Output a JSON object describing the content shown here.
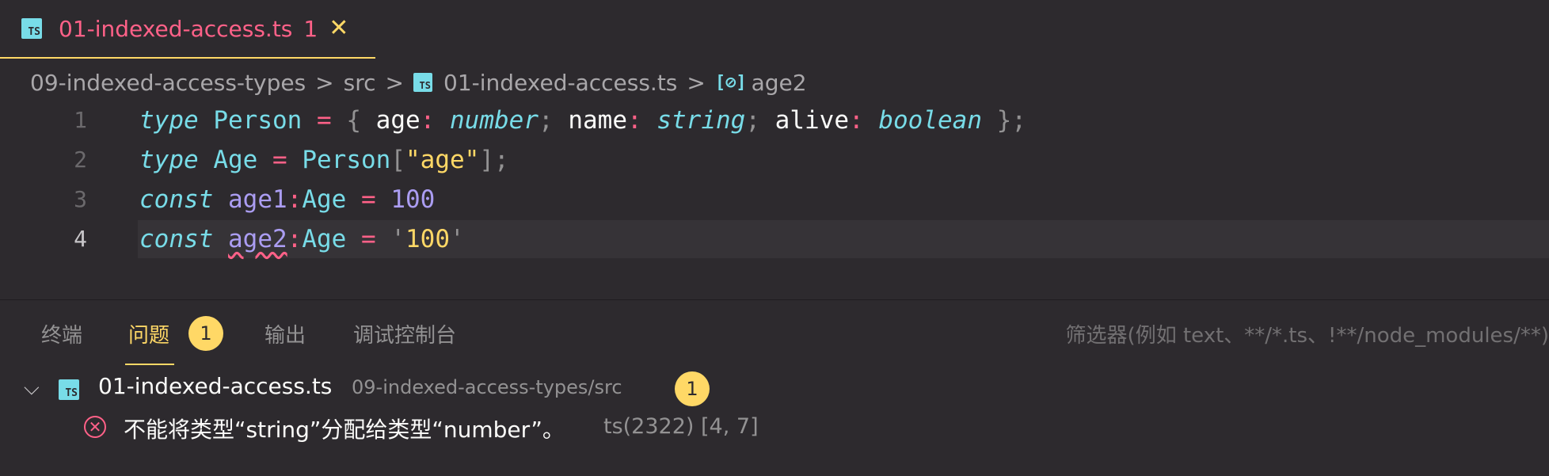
{
  "tab": {
    "title": "01-indexed-access.ts",
    "problem_count": "1",
    "close_glyph": "✕",
    "icon": "ts-file-icon"
  },
  "breadcrumb": {
    "items": [
      "09-indexed-access-types",
      "src",
      "01-indexed-access.ts",
      "age2"
    ],
    "separator": ">"
  },
  "editor": {
    "lines": [
      {
        "number": "1"
      },
      {
        "number": "2"
      },
      {
        "number": "3"
      },
      {
        "number": "4"
      }
    ],
    "tokens": {
      "type": "type",
      "person": "Person",
      "eq": "=",
      "lbrace": "{",
      "rbrace": "}",
      "age": "age",
      "colon": ":",
      "number": "number",
      "semi": ";",
      "name": "name",
      "string": "string",
      "alive": "alive",
      "boolean": "boolean",
      "age_type": "Age",
      "lbracket": "[",
      "rbracket": "]",
      "age_str": "\"age\"",
      "const": "const",
      "age1": "age1",
      "age2": "age2",
      "num100": "100",
      "quote": "'",
      "str100": "100"
    }
  },
  "panel": {
    "tabs": [
      "终端",
      "问题",
      "输出",
      "调试控制台"
    ],
    "problems_badge": "1",
    "filter_placeholder": "筛选器(例如 text、**/*.ts、!**/node_modules/**)",
    "file": {
      "name": "01-indexed-access.ts",
      "path": "09-indexed-access-types/src",
      "count": "1"
    },
    "error": {
      "message": "不能将类型“string”分配给类型“number”。",
      "code": "ts(2322)  [4, 7]"
    }
  },
  "colors": {
    "accent": "#ffd866",
    "error": "#ff6188",
    "background": "#2d2a2e"
  }
}
